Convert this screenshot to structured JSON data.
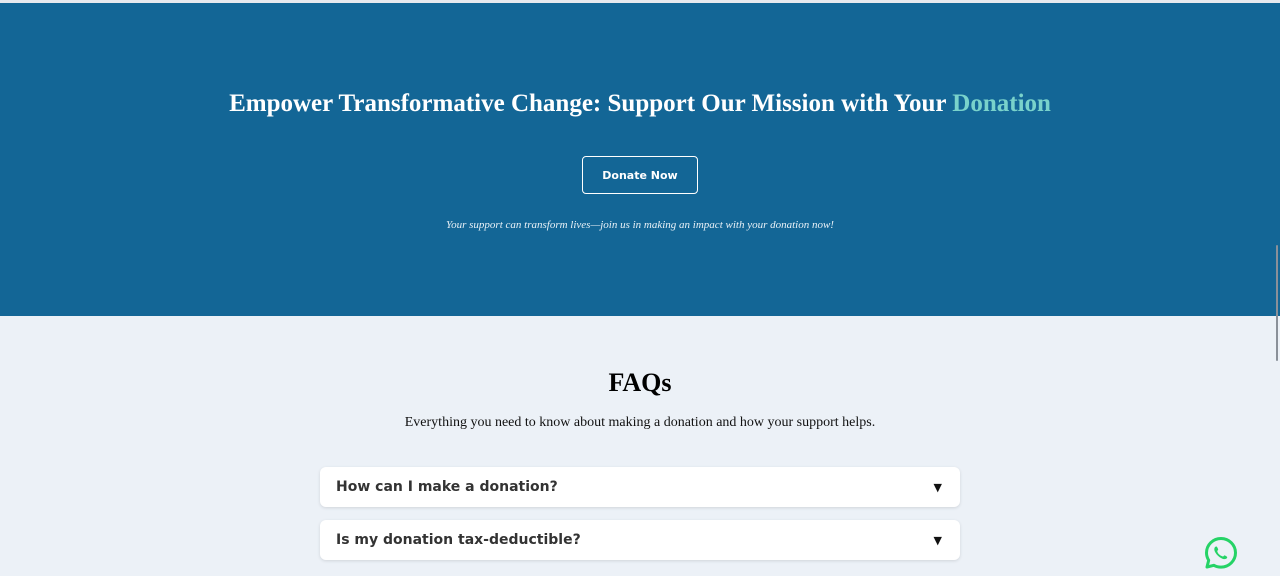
{
  "hero": {
    "title_main": "Empower Transformative Change: Support Our Mission with Your ",
    "title_accent": "Donation",
    "donate_button": "Donate Now",
    "subtitle": "Your support can transform lives—join us in making an impact with your donation now!",
    "background_color": "#136696",
    "accent_color": "#79d2cb"
  },
  "faq": {
    "title": "FAQs",
    "subtitle": "Everything you need to know about making a donation and how your support helps.",
    "items": [
      {
        "question": "How can I make a donation?",
        "toggle_icon": "▼"
      },
      {
        "question": "Is my donation tax-deductible?",
        "toggle_icon": "▼"
      }
    ]
  },
  "icons": {
    "chat": "whatsapp-icon",
    "toggle": "caret-down-icon"
  },
  "colors": {
    "page_background": "#ecf1f7",
    "whatsapp_green": "#25d366"
  }
}
